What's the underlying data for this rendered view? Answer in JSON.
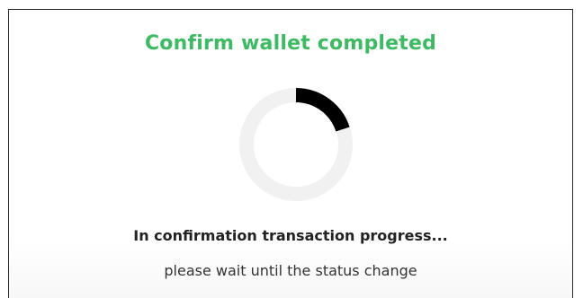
{
  "dialog": {
    "title": "Confirm wallet completed",
    "status_message": "In confirmation transaction progress...",
    "status_hint": "please wait until the status change"
  },
  "spinner": {
    "icon": "loading-spinner-icon",
    "track_color": "#f1f1f1",
    "arc_color": "#000000"
  },
  "colors": {
    "title": "#3dbb63",
    "text": "#222222"
  }
}
